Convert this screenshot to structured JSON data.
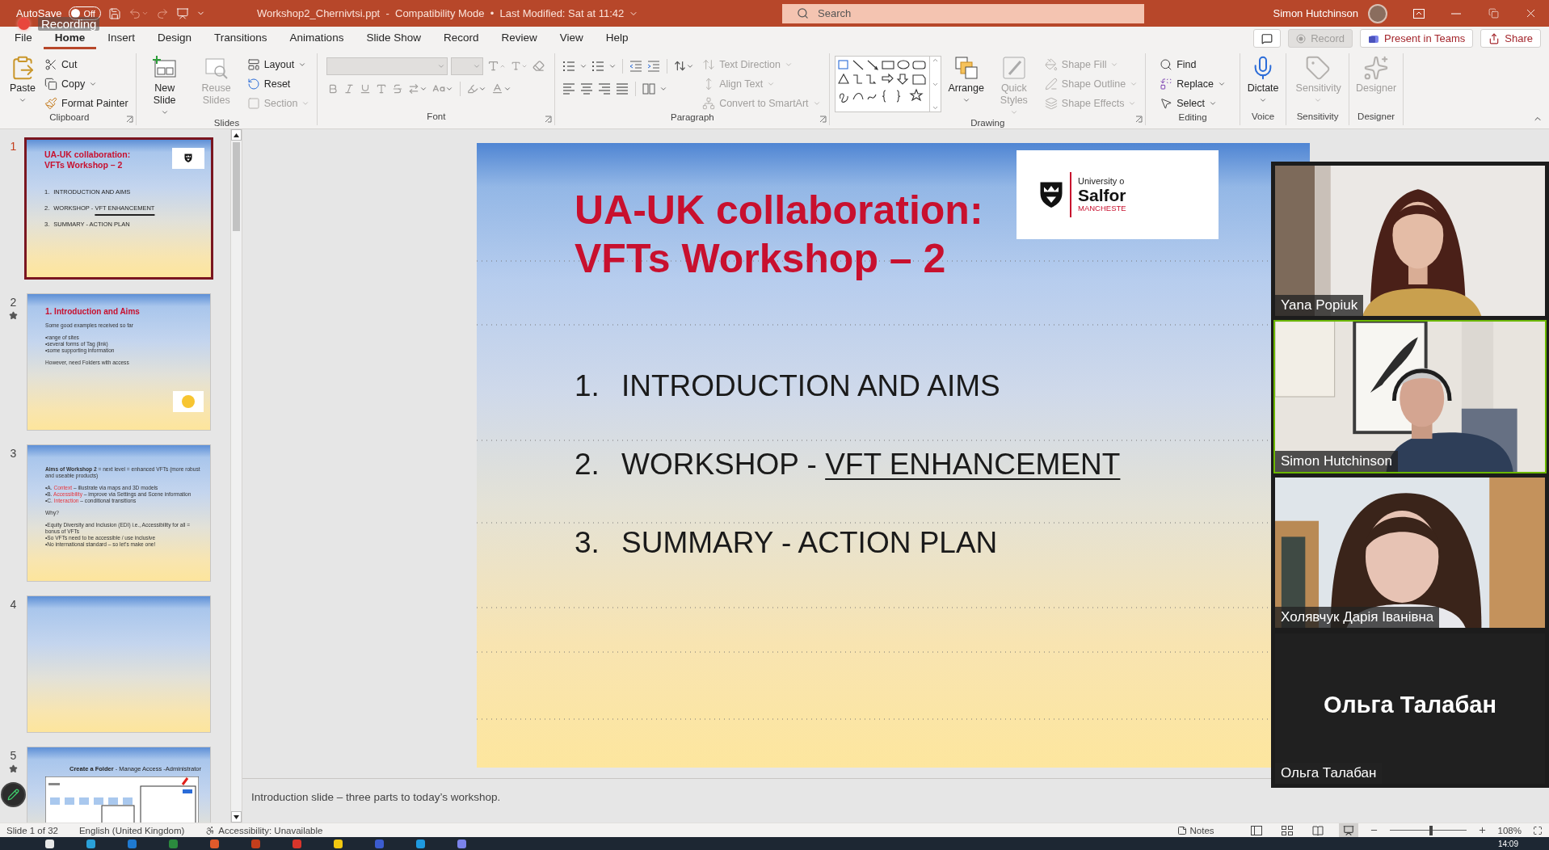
{
  "title_bar": {
    "autosave_label": "AutoSave",
    "autosave_state": "Off",
    "autosave_on": false,
    "recording_label": "Recording",
    "document_title": "Workshop2_Chernivtsi.ppt  -  Compatibility Mode  •  Last Modified: Sat at 11:42",
    "search_placeholder": "Search",
    "user_name": "Simon Hutchinson"
  },
  "menu_tabs": [
    {
      "label": "File",
      "selected": false
    },
    {
      "label": "Home",
      "selected": true
    },
    {
      "label": "Insert",
      "selected": false
    },
    {
      "label": "Design",
      "selected": false
    },
    {
      "label": "Transitions",
      "selected": false
    },
    {
      "label": "Animations",
      "selected": false
    },
    {
      "label": "Slide Show",
      "selected": false
    },
    {
      "label": "Record",
      "selected": false
    },
    {
      "label": "Review",
      "selected": false
    },
    {
      "label": "View",
      "selected": false
    },
    {
      "label": "Help",
      "selected": false
    }
  ],
  "header_buttons": [
    {
      "kind": "comments",
      "disabled": false
    },
    {
      "kind": "record",
      "label": "Record",
      "disabled": true
    },
    {
      "kind": "present",
      "label": "Present in Teams",
      "disabled": false
    },
    {
      "kind": "share",
      "label": "Share",
      "disabled": false
    }
  ],
  "ribbon_groups": [
    {
      "label": "Clipboard",
      "launcher": true,
      "columns": [
        {
          "kind": "large",
          "items": [
            {
              "label": "Paste",
              "dropdown": true,
              "disabled": false
            }
          ]
        },
        {
          "kind": "stack",
          "items": [
            {
              "label": "Cut",
              "dropdown": false,
              "disabled": false
            },
            {
              "label": "Copy",
              "dropdown": true,
              "disabled": false
            },
            {
              "label": "Format Painter",
              "dropdown": false,
              "disabled": false
            }
          ]
        }
      ]
    },
    {
      "label": "Slides",
      "launcher": false,
      "columns": [
        {
          "kind": "large",
          "items": [
            {
              "label": "New Slide",
              "dropdown": true,
              "disabled": false
            }
          ]
        },
        {
          "kind": "large",
          "items": [
            {
              "label": "Reuse Slides",
              "dropdown": false,
              "disabled": true
            }
          ]
        },
        {
          "kind": "stack",
          "items": [
            {
              "label": "Layout",
              "dropdown": true,
              "disabled": false
            },
            {
              "label": "Reset",
              "dropdown": false,
              "disabled": false
            },
            {
              "label": "Section",
              "dropdown": true,
              "disabled": true
            }
          ]
        }
      ]
    },
    {
      "label": "Font",
      "launcher": true,
      "columns": [
        {
          "kind": "font",
          "disabled": true
        }
      ]
    },
    {
      "label": "Paragraph",
      "launcher": true,
      "columns": [
        {
          "kind": "paragraph",
          "disabled": false
        },
        {
          "kind": "stack",
          "items": [
            {
              "label": "Text Direction",
              "dropdown": true,
              "disabled": true
            },
            {
              "label": "Align Text",
              "dropdown": true,
              "disabled": true
            },
            {
              "label": "Convert to SmartArt",
              "dropdown": true,
              "disabled": true
            }
          ]
        }
      ]
    },
    {
      "label": "Drawing",
      "launcher": true,
      "columns": [
        {
          "kind": "shapes",
          "disabled": false
        },
        {
          "kind": "large",
          "items": [
            {
              "label": "Arrange",
              "dropdown": true,
              "disabled": false
            }
          ]
        },
        {
          "kind": "large",
          "items": [
            {
              "label": "Quick Styles",
              "dropdown": true,
              "disabled": true
            }
          ]
        },
        {
          "kind": "stack",
          "items": [
            {
              "label": "Shape Fill",
              "dropdown": true,
              "disabled": true
            },
            {
              "label": "Shape Outline",
              "dropdown": true,
              "disabled": true
            },
            {
              "label": "Shape Effects",
              "dropdown": true,
              "disabled": true
            }
          ]
        }
      ]
    },
    {
      "label": "Editing",
      "launcher": false,
      "columns": [
        {
          "kind": "stack",
          "items": [
            {
              "label": "Find",
              "dropdown": false,
              "disabled": false
            },
            {
              "label": "Replace",
              "dropdown": true,
              "disabled": false
            },
            {
              "label": "Select",
              "dropdown": true,
              "disabled": false
            }
          ]
        }
      ]
    },
    {
      "label": "Voice",
      "launcher": false,
      "columns": [
        {
          "kind": "large",
          "items": [
            {
              "label": "Dictate",
              "dropdown": true,
              "disabled": false
            }
          ]
        }
      ]
    },
    {
      "label": "Sensitivity",
      "launcher": false,
      "columns": [
        {
          "kind": "large",
          "items": [
            {
              "label": "Sensitivity",
              "dropdown": true,
              "disabled": true
            }
          ]
        }
      ]
    },
    {
      "label": "Designer",
      "launcher": false,
      "columns": [
        {
          "kind": "large",
          "items": [
            {
              "label": "Designer",
              "dropdown": false,
              "disabled": true
            }
          ]
        }
      ]
    }
  ],
  "thumbnails": [
    {
      "number": "1",
      "selected": true,
      "starred": false,
      "sticker": false,
      "kind": "title",
      "title_lines": [
        "UA-UK collaboration:",
        "VFTs Workshop – 2"
      ],
      "agenda": [
        {
          "number": "1.",
          "text": "INTRODUCTION AND AIMS"
        },
        {
          "number": "2.",
          "text": "WORKSHOP - ",
          "underlined": "VFT ENHANCEMENT"
        },
        {
          "number": "3.",
          "text": "SUMMARY - ACTION PLAN"
        }
      ]
    },
    {
      "number": "2",
      "selected": false,
      "starred": true,
      "sticker": true,
      "kind": "bullets",
      "heading": "1. Introduction and Aims",
      "paragraphs": [
        [
          [
            {
              "text": "Some good examples received so far",
              "accent": false
            }
          ]
        ],
        [
          [
            {
              "text": "•range of sites",
              "accent": false
            }
          ],
          [
            {
              "text": "•several forms of Tag (link)",
              "accent": false
            }
          ],
          [
            {
              "text": "•some supporting information",
              "accent": false
            }
          ]
        ],
        [
          [
            {
              "text": "However, need Folders with access",
              "accent": false
            }
          ]
        ]
      ]
    },
    {
      "number": "3",
      "selected": false,
      "starred": false,
      "sticker": false,
      "kind": "bullets",
      "paragraphs": [
        [
          [
            {
              "text": "**Aims of Workshop 2** = next level = enhanced VFTs (more robust and useable products)",
              "accent": false
            }
          ]
        ],
        [
          [
            {
              "text": "•A. ",
              "accent": false
            },
            {
              "text": "Context",
              "accent": true
            },
            {
              "text": " – illustrate via maps and 3D models",
              "accent": false
            }
          ],
          [
            {
              "text": "•B. ",
              "accent": false
            },
            {
              "text": "Accessibility",
              "accent": true
            },
            {
              "text": " – improve via Settings and Scene information",
              "accent": false
            }
          ],
          [
            {
              "text": "•C. ",
              "accent": false
            },
            {
              "text": "Interaction",
              "accent": true
            },
            {
              "text": " – conditional transitions",
              "accent": false
            }
          ]
        ],
        [
          [
            {
              "text": "Why?",
              "accent": false
            }
          ]
        ],
        [
          [
            {
              "text": "•Equity Diversity and Inclusion (EDI) i.e., Accessibility for all = bonus of VFTs",
              "accent": false
            }
          ],
          [
            {
              "text": "•So VFTs need to be accessible / use inclusive",
              "accent": false
            }
          ],
          [
            {
              "text": "•No international standard – so let’s make one!",
              "accent": false
            }
          ]
        ]
      ]
    },
    {
      "number": "4",
      "selected": false,
      "starred": false,
      "sticker": false,
      "kind": "blank"
    },
    {
      "number": "5",
      "selected": false,
      "starred": true,
      "sticker": false,
      "kind": "screenshot",
      "heading": "Create a Folder",
      "subheading": " - Manage Access -Administrator"
    }
  ],
  "slide": {
    "title_lines": [
      "UA-UK collaboration:",
      "VFTs Workshop – 2"
    ],
    "agenda": [
      {
        "number": "1.",
        "text": "INTRODUCTION AND AIMS"
      },
      {
        "number": "2.",
        "text": "WORKSHOP - ",
        "underlined": "VFT ENHANCEMENT"
      },
      {
        "number": "3.",
        "text": "SUMMARY - ACTION PLAN"
      }
    ],
    "logo_lines": [
      "University o",
      "Salfor",
      "MANCHESTE"
    ]
  },
  "notes": "Introduction slide – three parts to today’s workshop.",
  "video_tiles": [
    {
      "kind": "video",
      "name": "Yana Popiuk",
      "active": false
    },
    {
      "kind": "video",
      "name": "Simon Hutchinson",
      "active": true
    },
    {
      "kind": "video",
      "name": "Холявчук Дарія Іванівна",
      "active": false
    },
    {
      "kind": "name_only",
      "display_name": "Ольга Талабан",
      "name": "Ольга Талабан",
      "active": false
    }
  ],
  "status_bar": {
    "slide_position": "Slide 1 of 32",
    "language": "English (United Kingdom)",
    "accessibility": "Accessibility: Unavailable",
    "notes_label": "Notes",
    "views": [
      {
        "kind": "normal",
        "selected": false
      },
      {
        "kind": "sorter",
        "selected": false
      },
      {
        "kind": "reading",
        "selected": false
      },
      {
        "kind": "slideshow",
        "selected": true
      }
    ],
    "zoom": {
      "level": 0.54,
      "reading": "108%"
    }
  },
  "taskbar": {
    "time": "14:09"
  }
}
